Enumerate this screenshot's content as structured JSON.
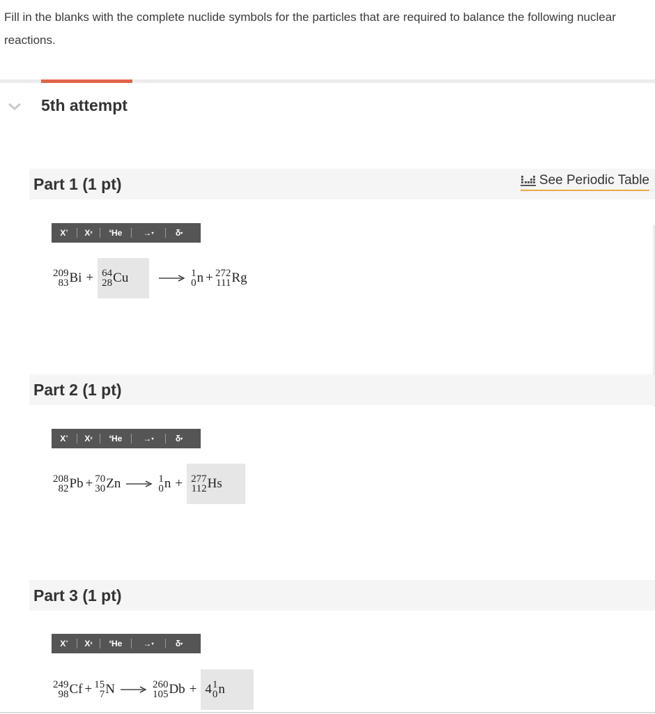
{
  "prompt": "Fill in the blanks with the complete nuclide symbols for the particles that are required to balance the following nuclear reactions.",
  "attempt_label": "5th attempt",
  "periodic_table_label": "See Periodic Table",
  "toolbar": {
    "superscript": "X",
    "subscript": "X",
    "nuclide": "He",
    "arrow": "→",
    "delta": "δ"
  },
  "parts": [
    {
      "title": "Part 1 (1 pt)",
      "r1": {
        "mass": "209",
        "num": "83",
        "sym": "Bi"
      },
      "r2": {
        "mass": "64",
        "num": "28",
        "sym": "Cu"
      },
      "p1": {
        "mass": "1",
        "num": "0",
        "sym": "n"
      },
      "p2": {
        "mass": "272",
        "num": "111",
        "sym": "Rg"
      },
      "plus": "+"
    },
    {
      "title": "Part 2 (1 pt)",
      "r1": {
        "mass": "208",
        "num": "82",
        "sym": "Pb"
      },
      "r2": {
        "mass": "70",
        "num": "30",
        "sym": "Zn"
      },
      "p1": {
        "mass": "1",
        "num": "0",
        "sym": "n"
      },
      "p2": {
        "mass": "277",
        "num": "112",
        "sym": "Hs"
      },
      "plus": "+"
    },
    {
      "title": "Part 3 (1 pt)",
      "r1": {
        "mass": "249",
        "num": "98",
        "sym": "Cf"
      },
      "r2": {
        "mass": "15",
        "num": "7",
        "sym": "N"
      },
      "p1": {
        "mass": "260",
        "num": "105",
        "sym": "Db"
      },
      "p2": {
        "coef": "4",
        "mass": "1",
        "num": "0",
        "sym": "n"
      },
      "plus": "+"
    }
  ]
}
